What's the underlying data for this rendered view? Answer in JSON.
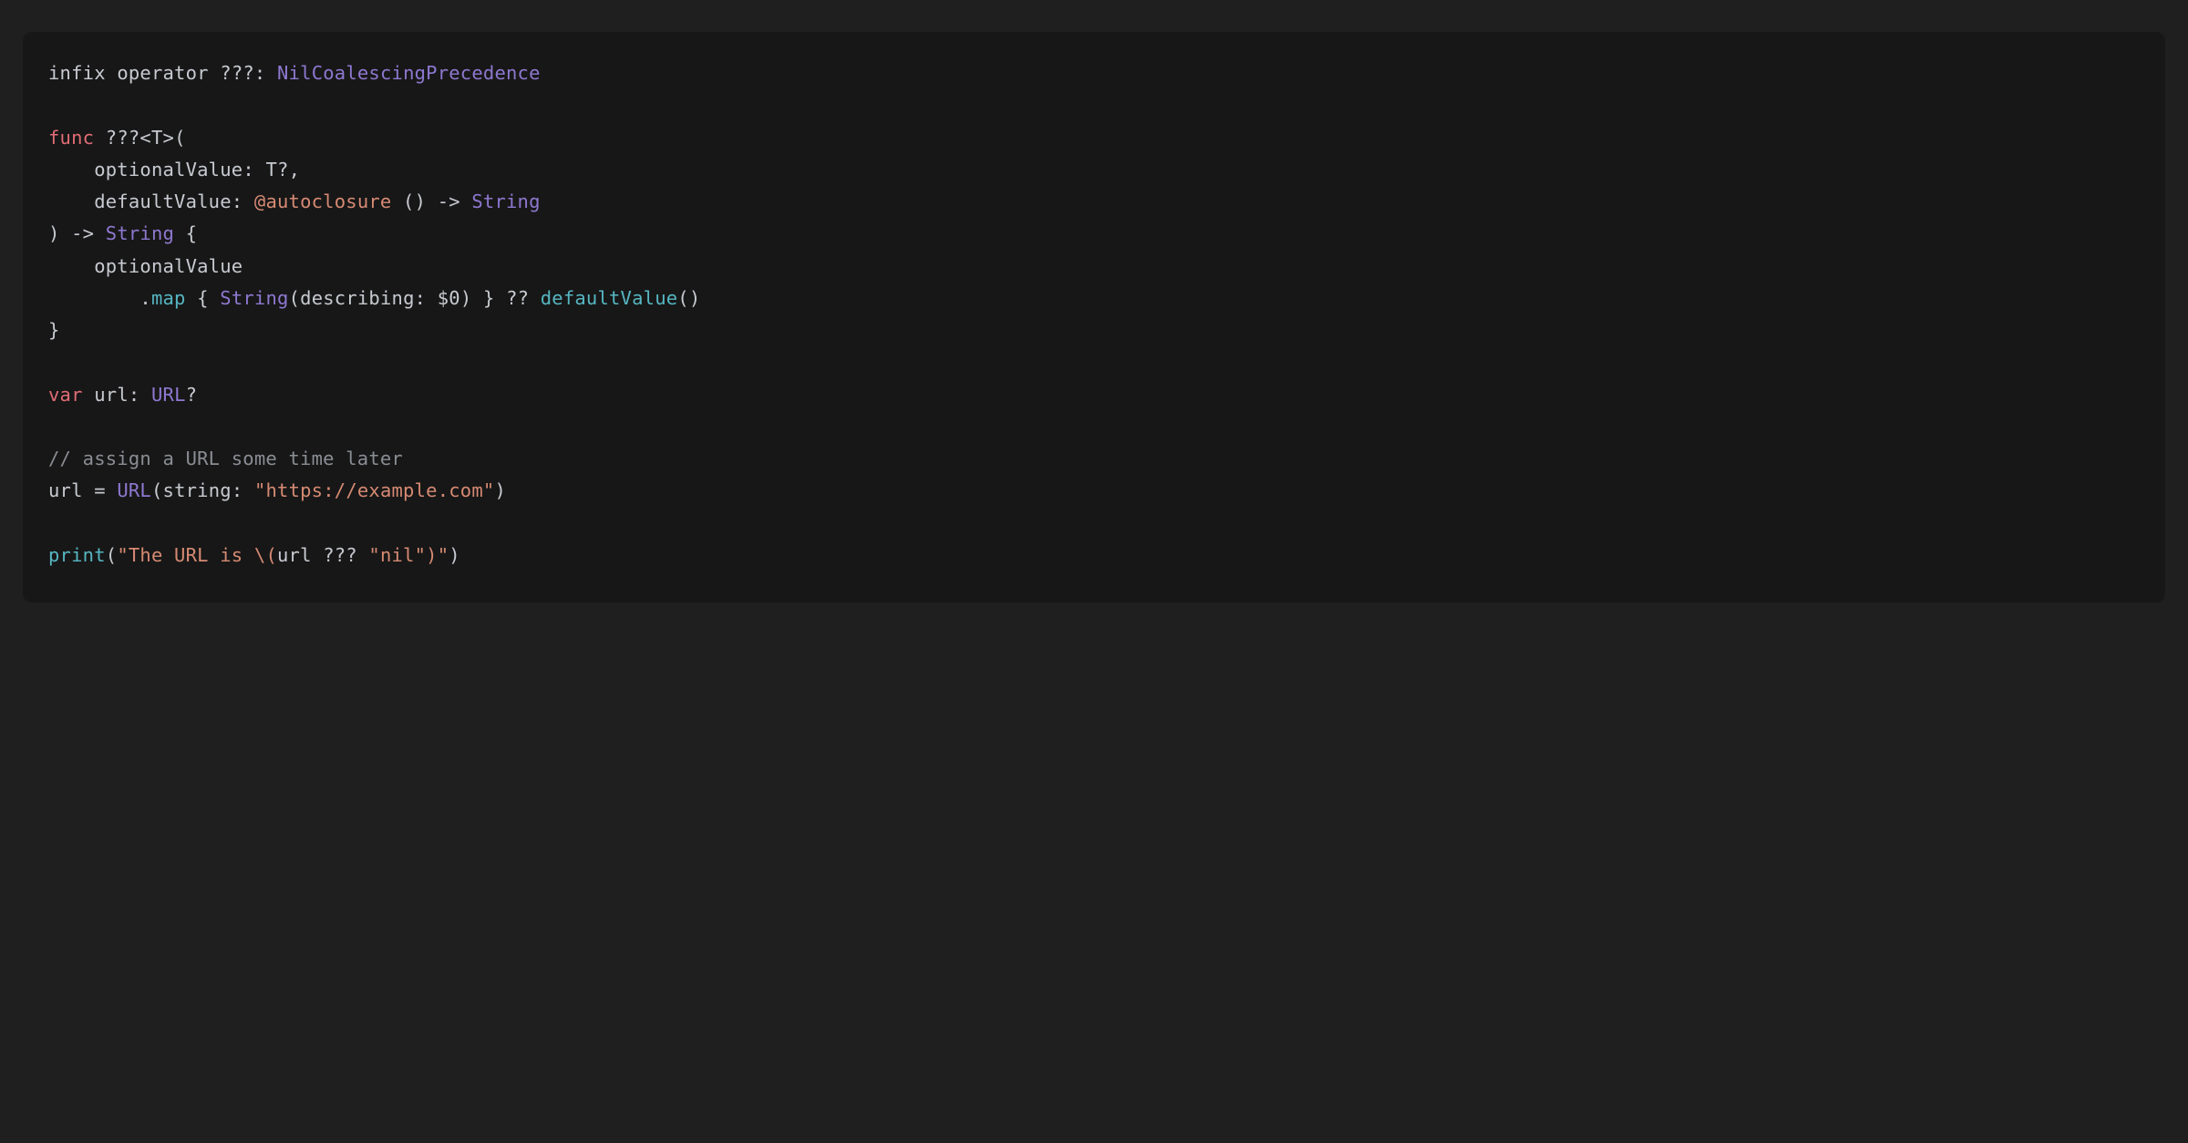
{
  "code": {
    "l1": {
      "infix": "infix",
      "operator": "operator",
      "op": "???",
      "colon": ":",
      "space": " ",
      "precedence": "NilCoalescingPrecedence"
    },
    "l2": "",
    "l3": {
      "func": "func",
      "space": " ",
      "name": "???",
      "generic": "<T>",
      "open": "("
    },
    "l4": {
      "indent": "    ",
      "param": "optionalValue",
      "colon": ": ",
      "type": "T",
      "opt": "?",
      "comma": ","
    },
    "l5": {
      "indent": "    ",
      "param": "defaultValue",
      "colon": ": ",
      "attr": "@autoclosure",
      "space": " ",
      "closure_open": "()",
      "arrow": " -> ",
      "ret": "String"
    },
    "l6": {
      "close": ")",
      "arrow": " -> ",
      "ret": "String",
      "space": " ",
      "brace": "{"
    },
    "l7": {
      "indent": "    ",
      "expr": "optionalValue"
    },
    "l8": {
      "indent": "        ",
      "dot": ".",
      "method": "map",
      "space": " ",
      "brace_open": "{ ",
      "type": "String",
      "paren_open": "(",
      "label": "describing",
      "colon": ": ",
      "arg": "$0",
      "paren_close": ")",
      "brace_close": " }",
      "nilcoal": " ?? ",
      "call": "defaultValue",
      "call_parens": "()"
    },
    "l9": {
      "brace": "}"
    },
    "l10": "",
    "l11": {
      "var": "var",
      "space": " ",
      "name": "url",
      "colon": ": ",
      "type": "URL",
      "opt": "?"
    },
    "l12": "",
    "l13": {
      "comment": "// assign a URL some time later"
    },
    "l14": {
      "lhs": "url",
      "eq": " = ",
      "type": "URL",
      "paren_open": "(",
      "label": "string",
      "colon": ": ",
      "string": "\"https://example.com\"",
      "paren_close": ")"
    },
    "l15": "",
    "l16": {
      "call": "print",
      "paren_open": "(",
      "str_open": "\"The URL is ",
      "interp_open": "\\(",
      "var": "url",
      "op": " ??? ",
      "lit": "\"nil\"",
      "interp_close": ")",
      "str_close": "\"",
      "paren_close": ")"
    }
  }
}
